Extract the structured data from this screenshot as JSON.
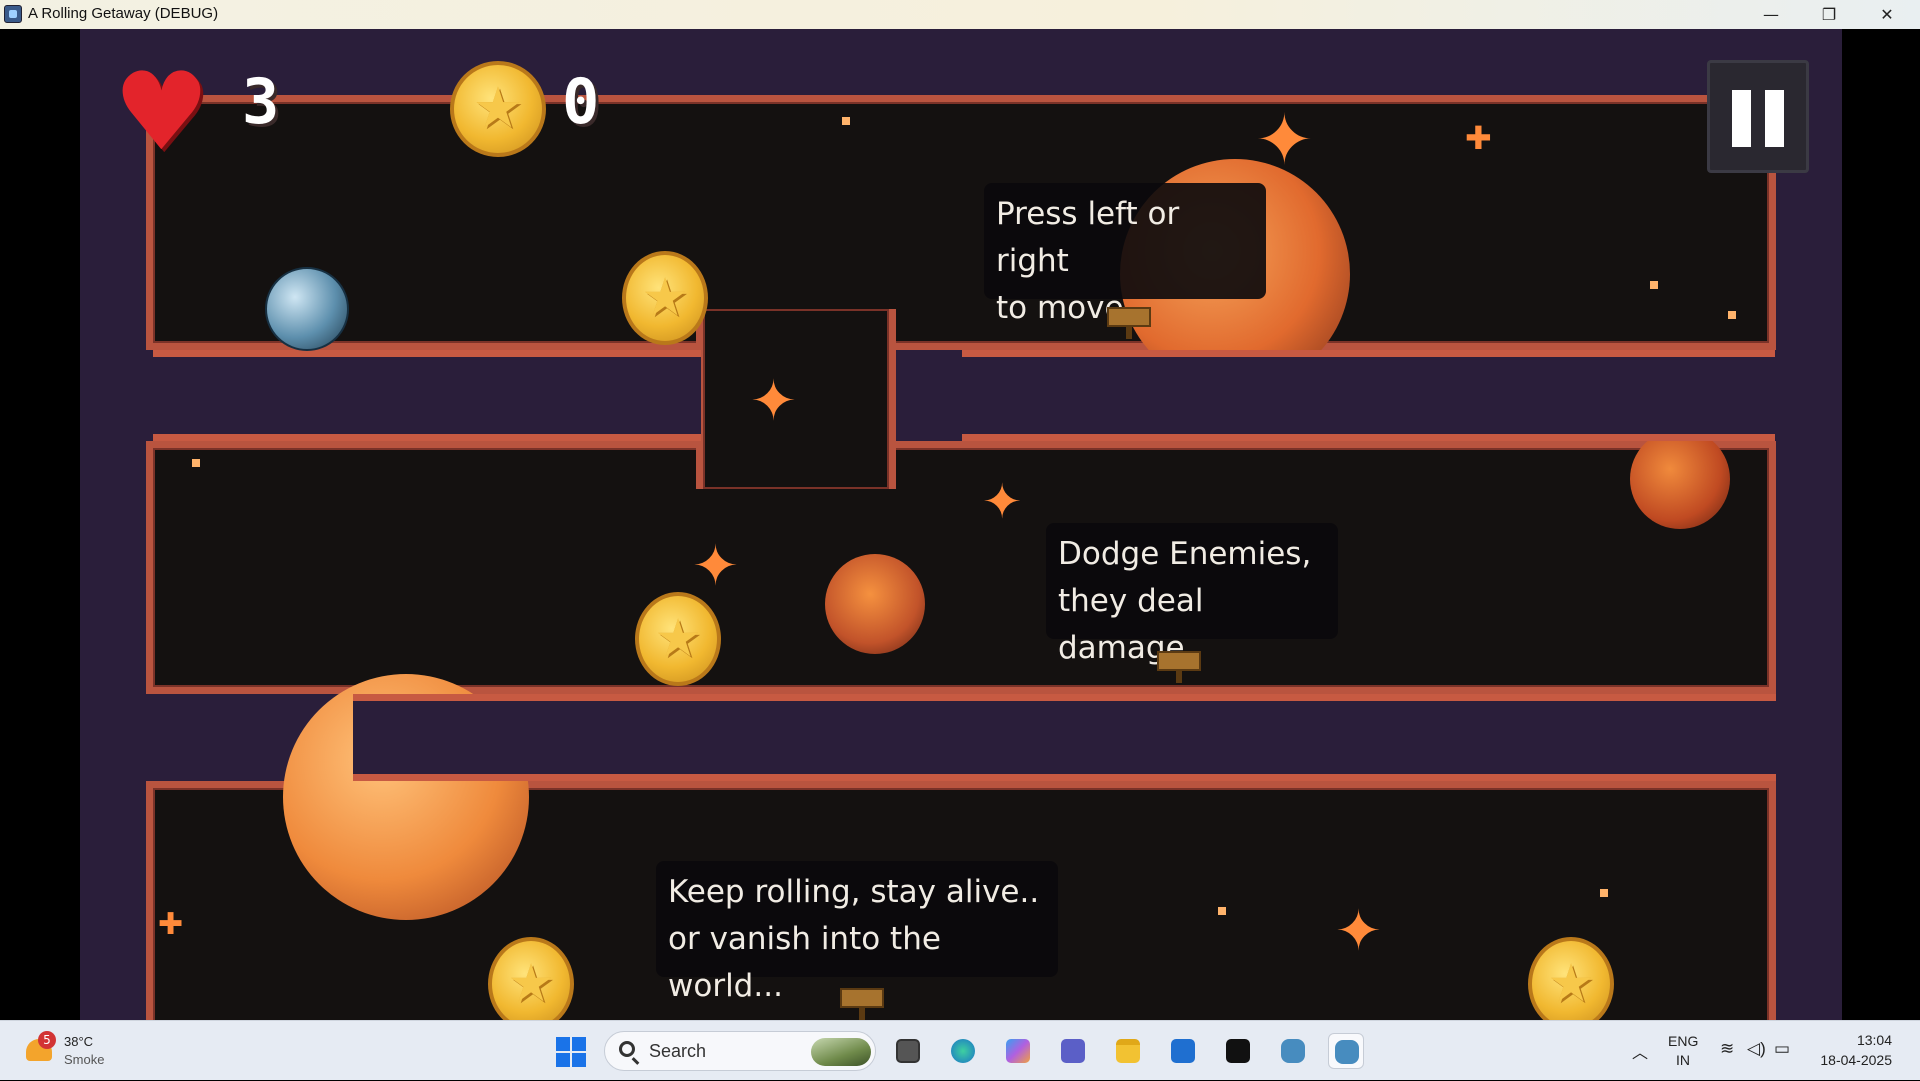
{
  "window": {
    "title": "A Rolling Getaway (DEBUG)",
    "controls": {
      "minimize": "—",
      "restore": "❐",
      "close": "✕"
    }
  },
  "hud": {
    "lives": "3",
    "coins": "0",
    "pause_icon": "pause-icon"
  },
  "hints": {
    "move": "Press left or right\n to move..",
    "dodge": "Dodge Enemies,\nthey deal damage..",
    "keep_rolling": "Keep rolling, stay alive..\nor vanish into the world..."
  },
  "colors": {
    "cave_border": "#b9543f",
    "background_rock": "#2a1e3a",
    "cave_interior": "#141110",
    "coin_gold": "#f1b830",
    "hint_bg": "#0a090c"
  },
  "taskbar": {
    "weather": {
      "badge": "5",
      "temp": "38°C",
      "condition": "Smoke"
    },
    "search_placeholder": "Search",
    "lang_line1": "ENG",
    "lang_line2": "IN",
    "time": "13:04",
    "date": "18-04-2025"
  }
}
